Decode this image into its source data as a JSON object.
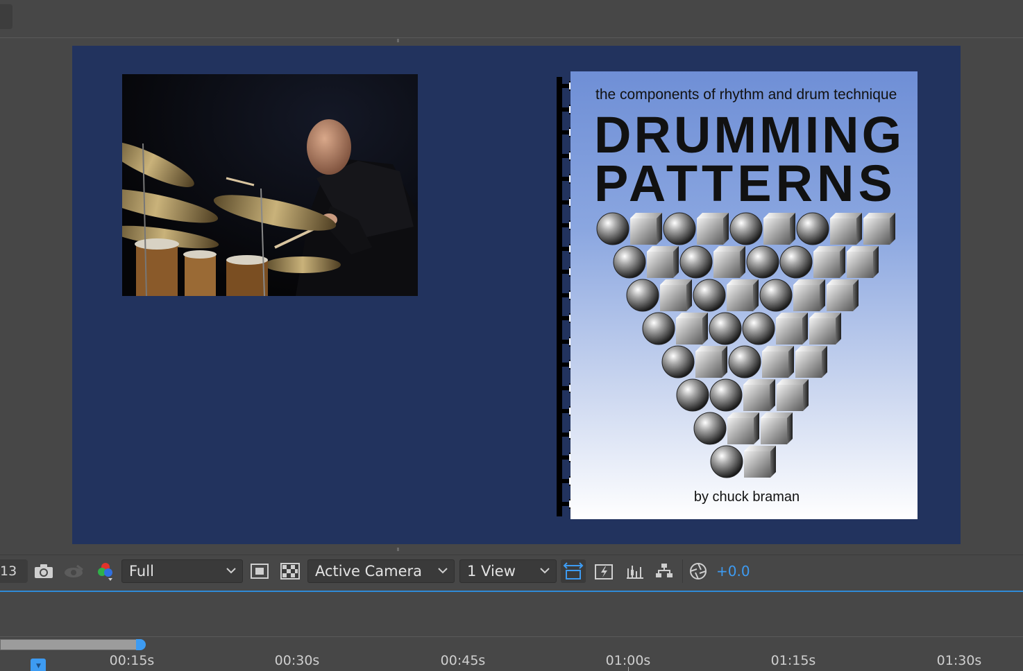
{
  "toolbar": {
    "magnification": "13",
    "resolution": "Full",
    "camera": "Active Camera",
    "views": "1 View",
    "exposure": "+0.0",
    "accent_color": "#3d9bf2"
  },
  "viewer": {
    "comp_background": "#22335e",
    "book": {
      "subtitle": "the components of rhythm and drum technique",
      "title_line1": "DRUMMING",
      "title_line2": "PATTERNS",
      "author": "by chuck braman"
    }
  },
  "timeline": {
    "ticks": [
      "00:15s",
      "00:30s",
      "00:45s",
      "01:00s",
      "01:15s",
      "01:30s"
    ]
  }
}
